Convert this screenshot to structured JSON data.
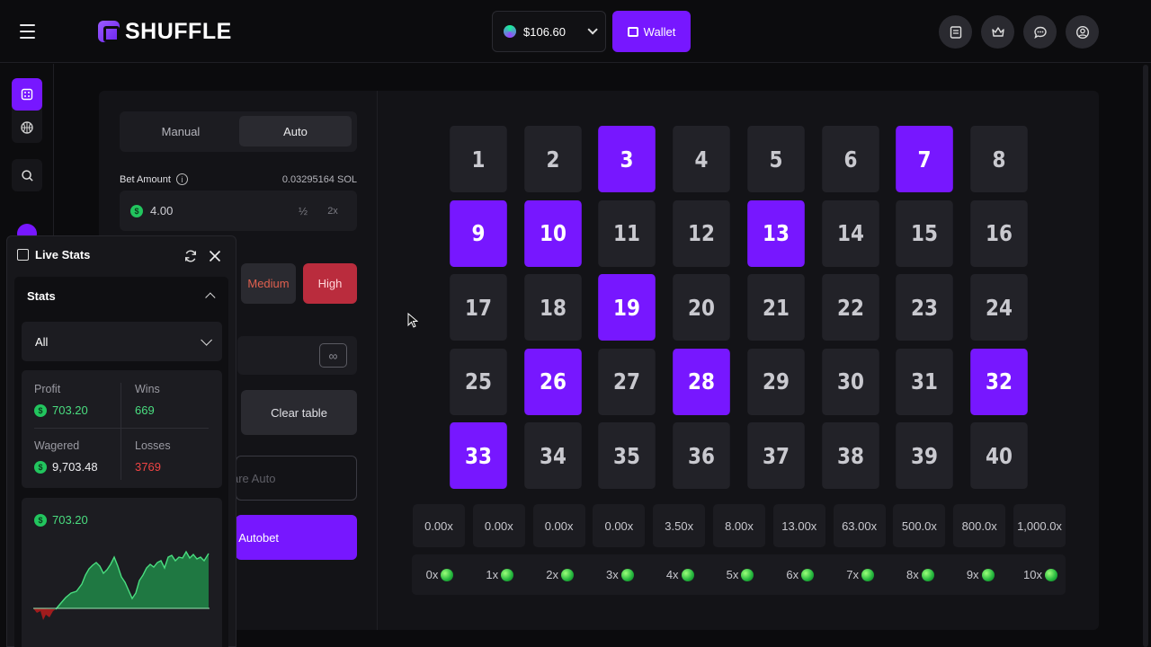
{
  "header": {
    "logo": "SHUFFLE",
    "balance": "$106.60",
    "wallet_label": "Wallet"
  },
  "controls": {
    "tabs": [
      "Manual",
      "Auto"
    ],
    "active_tab": "Auto",
    "bet_amount_label": "Bet Amount",
    "bet_amount_sol": "0.03295164 SOL",
    "bet_amount_value": "4.00",
    "half_label": "½",
    "double_label": "2x",
    "risk_medium": "Medium",
    "risk_high": "High",
    "infinity_label": "∞",
    "clear_table": "Clear table",
    "compare_auto": "are Auto",
    "start_autobet": "› Autobet"
  },
  "grid": {
    "numbers": [
      1,
      2,
      3,
      4,
      5,
      6,
      7,
      8,
      9,
      10,
      11,
      12,
      13,
      14,
      15,
      16,
      17,
      18,
      19,
      20,
      21,
      22,
      23,
      24,
      25,
      26,
      27,
      28,
      29,
      30,
      31,
      32,
      33,
      34,
      35,
      36,
      37,
      38,
      39,
      40
    ],
    "selected": [
      3,
      7,
      9,
      10,
      13,
      19,
      26,
      28,
      32,
      33
    ]
  },
  "payouts": [
    "0.00x",
    "0.00x",
    "0.00x",
    "0.00x",
    "3.50x",
    "8.00x",
    "13.00x",
    "63.00x",
    "500.0x",
    "800.0x",
    "1,000.0x"
  ],
  "hits": [
    "0x",
    "1x",
    "2x",
    "3x",
    "4x",
    "5x",
    "6x",
    "7x",
    "8x",
    "9x",
    "10x"
  ],
  "live_stats": {
    "title": "Live Stats",
    "section": "Stats",
    "filter": "All",
    "profit_label": "Profit",
    "profit_value": "703.20",
    "wins_label": "Wins",
    "wins_value": "669",
    "wagered_label": "Wagered",
    "wagered_value": "9,703.48",
    "losses_label": "Losses",
    "losses_value": "3769",
    "chart_value": "703.20"
  },
  "colors": {
    "accent": "#7717ff",
    "win": "#4ade80",
    "loss": "#ef4444",
    "risk_high": "#ba2c3d"
  }
}
